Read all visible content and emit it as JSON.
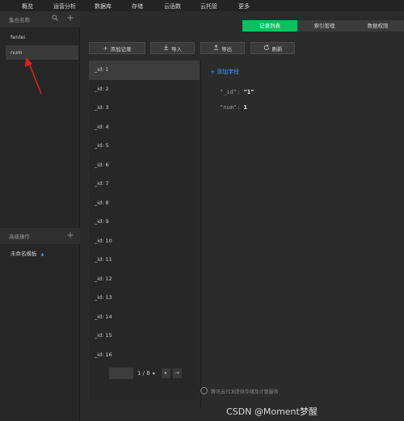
{
  "topnav": {
    "items": [
      "概览",
      "运营分析",
      "数据库",
      "存储",
      "云函数",
      "云托管",
      "更多"
    ]
  },
  "sidebar": {
    "collections_title": "集合名称",
    "collections": [
      "fenlei",
      "num"
    ],
    "advanced_title": "高级操作",
    "template_item": "未命名模板",
    "template_caret": "▲"
  },
  "tabs": [
    "记录列表",
    "索引管理",
    "数据权限"
  ],
  "toolbar": {
    "add_label": "添加记录",
    "import_label": "导入",
    "export_label": "导出",
    "refresh_label": "刷新"
  },
  "records": [
    "_id: 1",
    "_id: 2",
    "_id: 3",
    "_id: 4",
    "_id: 5",
    "_id: 6",
    "_id: 7",
    "_id: 8",
    "_id: 9",
    "_id: 10",
    "_id: 11",
    "_id: 12",
    "_id: 13",
    "_id: 14",
    "_id: 15",
    "_id: 16"
  ],
  "detail": {
    "add_field_label": "添加字段",
    "fields": [
      {
        "key": "\"_id\":",
        "value": "\"1\""
      },
      {
        "key": "\"num\":",
        "value": "1"
      }
    ]
  },
  "pager": {
    "text": "1 / 8",
    "dropdown": "▾",
    "next": "▸",
    "last": "⇥"
  },
  "footer": {
    "text": "腾讯云TCB提供存储及计算服务",
    "watermark": "CSDN @Moment梦醒"
  },
  "colors": {
    "accent_green": "#07c160",
    "link_blue": "#3b9dff",
    "annotation_red": "#e02020"
  }
}
